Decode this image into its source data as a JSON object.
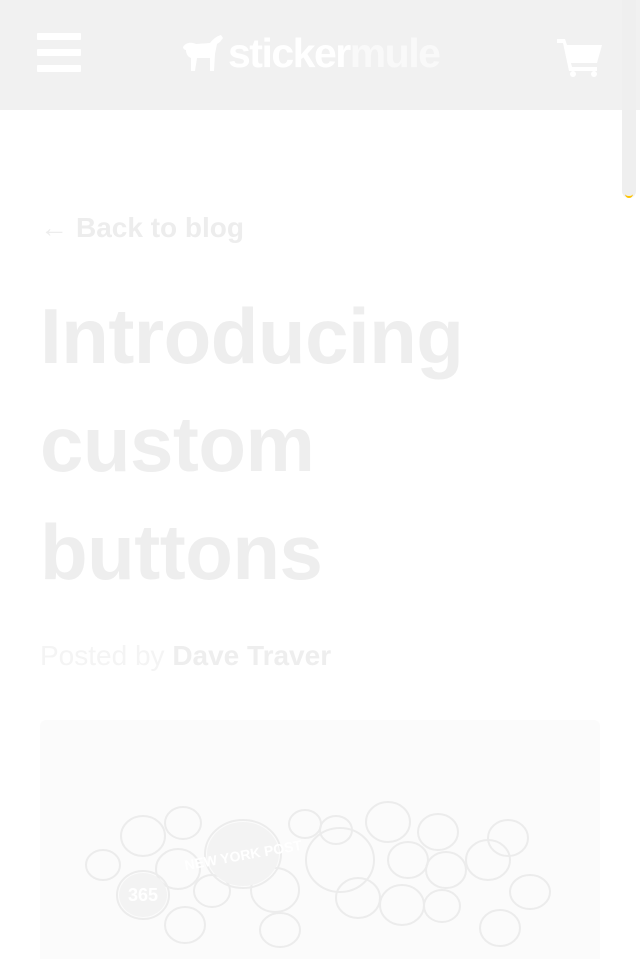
{
  "header": {
    "logo": {
      "part1": "sticker",
      "part2": "mule"
    }
  },
  "post": {
    "back_arrow": "←",
    "back_label": "Back to blog",
    "title": "Introducing custom buttons",
    "byline_prefix": "Posted by",
    "author": "Dave Traver"
  },
  "hero": {
    "buttons": [
      {
        "text": "NEW YORK POST"
      },
      {
        "text": "365"
      }
    ]
  },
  "colors": {
    "header_bg": "#f1f1f1",
    "text_faint": "#eeeeee",
    "accent": "#ffc400"
  }
}
